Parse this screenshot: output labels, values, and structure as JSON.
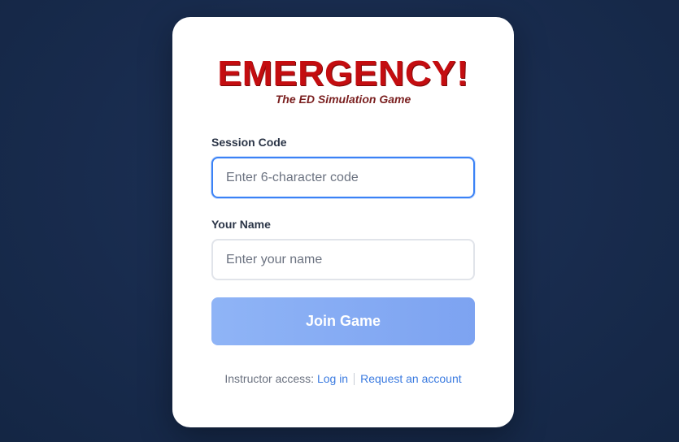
{
  "logo": {
    "title": "EMERGENCY!",
    "subtitle": "The ED Simulation Game"
  },
  "form": {
    "session_code": {
      "label": "Session Code",
      "placeholder": "Enter 6-character code",
      "value": ""
    },
    "your_name": {
      "label": "Your Name",
      "placeholder": "Enter your name",
      "value": ""
    },
    "join_button_label": "Join Game"
  },
  "footer": {
    "instructor_prefix": "Instructor access:",
    "login_link": "Log in",
    "request_link": "Request an account"
  },
  "colors": {
    "background": "#182b4d",
    "card": "#ffffff",
    "logo_red": "#c40d10",
    "accent_blue": "#3b82f6",
    "button_blue": "#8fb4f6",
    "link_blue": "#3b7be0"
  }
}
